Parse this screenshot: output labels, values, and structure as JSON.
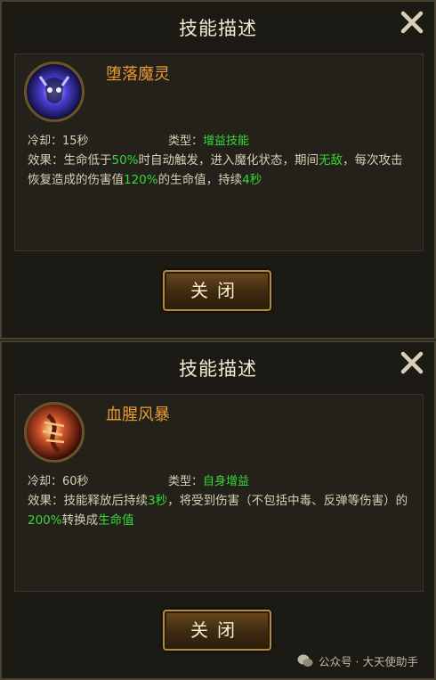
{
  "dialogs": [
    {
      "title": "技能描述",
      "skill_name": "堕落魔灵",
      "cooldown_label": "冷却：",
      "cooldown_value": "15秒",
      "type_label": "类型：",
      "type_value": "增益技能",
      "effect": {
        "p1": "效果：生命低于",
        "v1": "50%",
        "p2": "时自动触发，进入魔化状态，期间",
        "v2": "无敌",
        "p3": "，每次攻击恢复造成的伤害值",
        "v3": "120%",
        "p4": "的生命值，持续",
        "v4": "4秒"
      },
      "button_label": "关闭",
      "skill_icon": "demon-spirit-icon"
    },
    {
      "title": "技能描述",
      "skill_name": "血腥风暴",
      "cooldown_label": "冷却：",
      "cooldown_value": "60秒",
      "type_label": "类型：",
      "type_value": "自身增益",
      "effect": {
        "p1": "效果：技能释放后持续",
        "v1": "3秒",
        "p2": "，将受到伤害（不包括中毒、反弹等伤害）的",
        "v2": "200%",
        "p3": "转换成",
        "v3": "生命值"
      },
      "button_label": "关闭",
      "skill_icon": "blood-storm-icon"
    }
  ],
  "watermark": "公众号 · 大天使助手",
  "colors": {
    "title": "#f3ead2",
    "skill_name": "#e79a35",
    "highlight": "#37d83a",
    "button_border": "#b58a3a"
  }
}
